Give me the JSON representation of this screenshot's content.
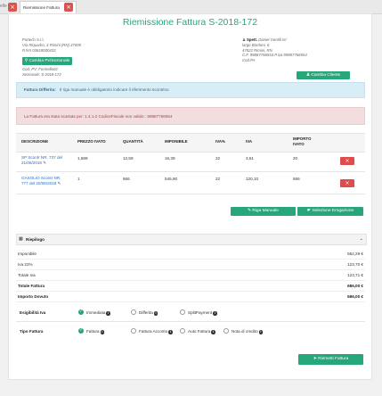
{
  "tabs": [
    {
      "label": "elle",
      "closable": true
    },
    {
      "label": "Riemissione Fattura",
      "active": true,
      "closable": true
    }
  ],
  "page_title": "Riemissione Fattura S-2018-172",
  "supplier": {
    "name": "Portech S.r.l.",
    "address": "Via Riquadro, 4 Rimini (RN) 47000",
    "piva": "P.IVA 03618000433",
    "button": "Cambia Pv/Sezionale",
    "cod_pv": "Cod. PV: Formello02",
    "sezionale": "Sezionale: S-2018-172"
  },
  "client": {
    "label": "Spett.",
    "name": "Daniel Gentili srl",
    "street": "largo Bordoni, 6",
    "city": "47822 Rimini, RN",
    "cf": "C.F. 99887766554 P.iva 99887766554",
    "cod_pa": "Cod.PA",
    "button": "Cambia Cliente"
  },
  "alert_info": {
    "bold": "Fattura Differita:",
    "text": "Il riga manuale è obbligatorio indicare il riferimento scontrino"
  },
  "alert_error": {
    "text": "La Fattura era stata scartata per: 1.4.1.2 CodiceFiscale non valido : 99887766554"
  },
  "table": {
    "headers": [
      "DESCRIZIONE",
      "PREZZO IVATO",
      "QUANTITÀ",
      "IMPONIBILE",
      "IVA%",
      "IVA",
      "IMPORTO IVATO"
    ],
    "rows": [
      {
        "descr1": "SP Scontr NR. 737 del",
        "descr2": "21/06/2018",
        "prezzo": "1,589",
        "quantita": "12,59",
        "imponibile": "16,39",
        "iva_pct": "22",
        "iva": "3,61",
        "importo": "20"
      },
      {
        "descr1": "GASOLIO Scontr NR.",
        "descr2": "777 del 20/06/2018",
        "prezzo": "1",
        "quantita": "666",
        "imponibile": "545,90",
        "iva_pct": "22",
        "iva": "120,10",
        "importo": "666"
      }
    ]
  },
  "buttons": {
    "riga_manuale": "Riga Manuale",
    "selezione": "Selezione Erogazione",
    "riemetti": "Riemetti Fattura"
  },
  "riepilogo": {
    "title": "Riepilogo",
    "rows": [
      {
        "label": "Imponibile",
        "value": "562,29 €",
        "bold": false
      },
      {
        "label": "Iva 22%",
        "value": "123,70 €",
        "bold": false
      },
      {
        "label": "Totale Iva",
        "value": "123,71 €",
        "bold": false
      },
      {
        "label": "Totale Fattura",
        "value": "686,00 €",
        "bold": true
      },
      {
        "label": "Importo Dovuto",
        "value": "686,00 €",
        "bold": true
      }
    ]
  },
  "esigibilita": {
    "label": "Esigibilità Iva",
    "options": [
      "Immediata",
      "Differita",
      "SplitPayment"
    ],
    "selected": "Immediata"
  },
  "tipo_fattura": {
    "label": "Tipo Fattura",
    "options": [
      "Fattura",
      "Fattura Acconto",
      "Auto Fattura",
      "Nota di credito"
    ],
    "selected": "Fattura"
  }
}
